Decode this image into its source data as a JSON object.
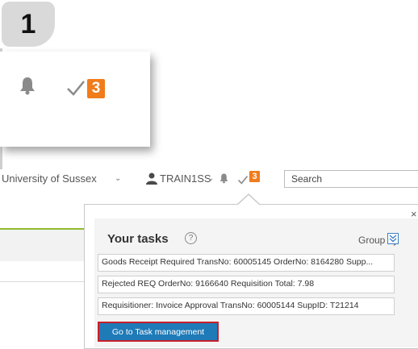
{
  "step": {
    "number": "1"
  },
  "zoom": {
    "bell_icon": "bell-icon",
    "check_icon": "check-icon",
    "task_count": "3"
  },
  "header": {
    "organization": "University of Sussex",
    "user": "TRAIN1SS",
    "task_count": "3",
    "search_placeholder": "Search"
  },
  "tasks_popup": {
    "close_glyph": "×",
    "title": "Your tasks",
    "help_glyph": "?",
    "group_by_label": "Group by",
    "tasks": [
      "Goods Receipt Required TransNo: 60005145 OrderNo: 8164280 Supp...",
      "Rejected REQ OrderNo: 9166640 Requisition Total: 7.98",
      "Requisitioner: Invoice Approval TransNo: 60005144 SuppID: T21214"
    ],
    "goto_button": "Go to Task management"
  },
  "colors": {
    "badge_orange": "#f07c1c",
    "accent_green": "#8dbb2a",
    "button_blue": "#1f7ab8",
    "highlight_red": "#c8202a"
  }
}
